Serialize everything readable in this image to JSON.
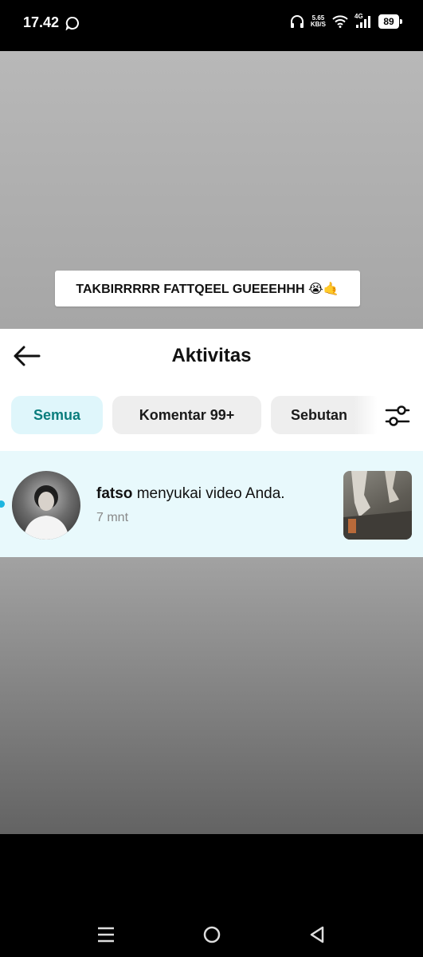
{
  "status_bar": {
    "time": "17.42",
    "net_speed_value": "5.65",
    "net_speed_unit": "KB/S",
    "network_type": "4G",
    "battery": "89",
    "icons": [
      "chat-bubble-icon",
      "headphones-icon",
      "wifi-icon",
      "signal-icon",
      "battery-icon"
    ]
  },
  "video": {
    "caption": "TAKBIRRRRR FATTQEEL GUEEEHHH 😭🤙"
  },
  "header": {
    "title": "Aktivitas",
    "back_icon": "arrow-left-icon",
    "filter_icon": "sliders-icon"
  },
  "tabs": [
    {
      "label": "Semua",
      "active": true
    },
    {
      "label": "Komentar 99+",
      "active": false
    },
    {
      "label": "Sebutan",
      "active": false
    }
  ],
  "notifications": [
    {
      "username": "fatso",
      "message": "menyukai video Anda.",
      "time": "7 mnt",
      "unread": true
    }
  ],
  "nav": {
    "icons": [
      "menu-icon",
      "home-circle-icon",
      "back-triangle-icon"
    ]
  },
  "colors": {
    "accent": "#0a7d7d",
    "active_tab_bg": "#dff6fb",
    "notification_bg": "#e8f9fc",
    "unread_dot": "#1db6e0"
  }
}
